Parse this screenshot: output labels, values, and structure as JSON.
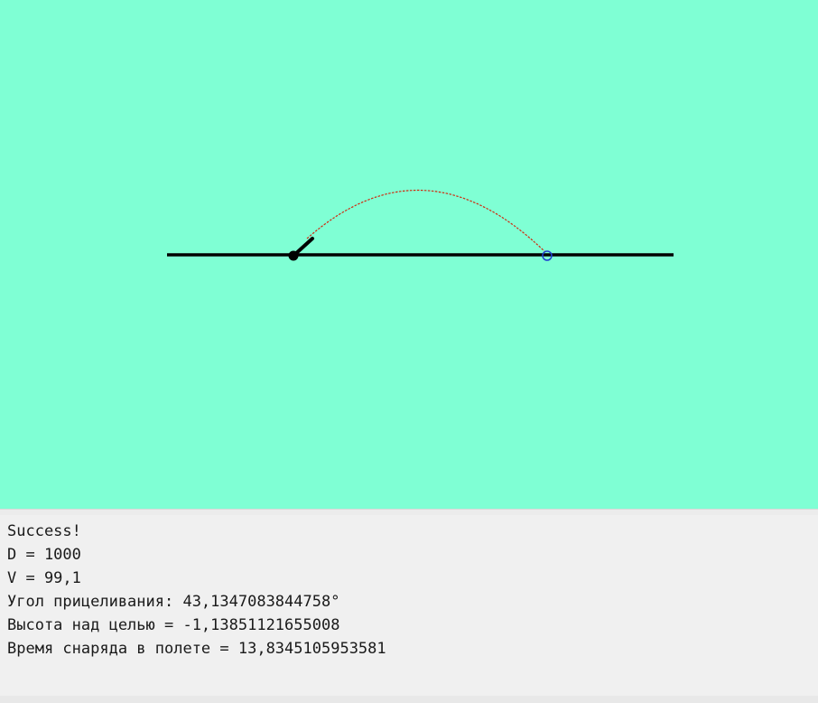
{
  "colors": {
    "canvas_background": "#7fffd4",
    "ground": "#000000",
    "cannon": "#000000",
    "trajectory": "#d02a10",
    "target": "#2040d0",
    "output_background": "#f0f0f0",
    "output_text": "#1a1a1a"
  },
  "output": {
    "lines": [
      "Success!",
      "D = 1000",
      "V = 99,1",
      "Угол прицеливания: 43,1347083844758°",
      "Высота над целью = -1,13851121655008",
      "Время снаряда в полете = 13,8345105953581"
    ]
  }
}
